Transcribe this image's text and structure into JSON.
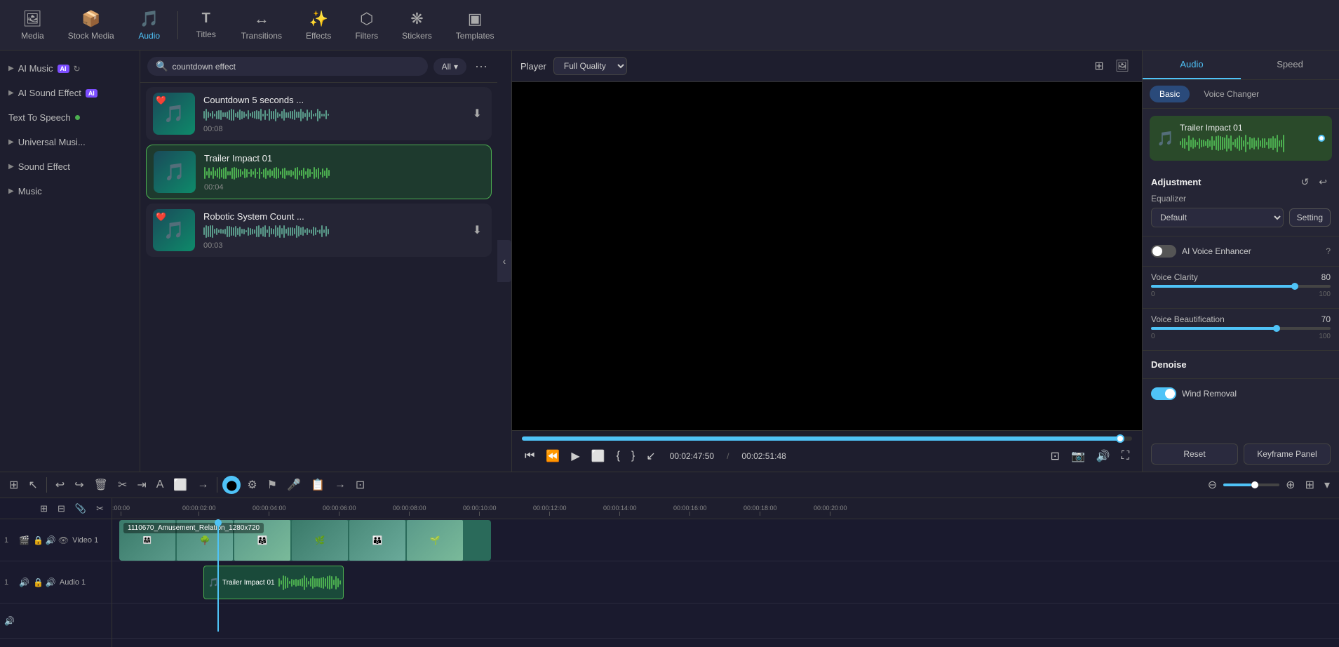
{
  "app": {
    "title": "Video Editor"
  },
  "toolbar": {
    "items": [
      {
        "id": "media",
        "label": "Media",
        "icon": "🖼",
        "active": false
      },
      {
        "id": "stock-media",
        "label": "Stock Media",
        "icon": "📦",
        "active": false
      },
      {
        "id": "audio",
        "label": "Audio",
        "icon": "🎵",
        "active": true
      },
      {
        "id": "titles",
        "label": "Titles",
        "icon": "T",
        "active": false
      },
      {
        "id": "transitions",
        "label": "Transitions",
        "icon": "↔",
        "active": false
      },
      {
        "id": "effects",
        "label": "Effects",
        "icon": "✨",
        "active": false
      },
      {
        "id": "filters",
        "label": "Filters",
        "icon": "⬡",
        "active": false
      },
      {
        "id": "stickers",
        "label": "Stickers",
        "icon": "❋",
        "active": false
      },
      {
        "id": "templates",
        "label": "Templates",
        "icon": "▣",
        "active": false
      }
    ]
  },
  "sidebar": {
    "items": [
      {
        "id": "ai-music",
        "label": "AI Music",
        "badge": "AI",
        "badge_type": "ai",
        "arrow": true
      },
      {
        "id": "ai-sound-effect",
        "label": "AI Sound Effect",
        "badge": "AI",
        "badge_type": "ai",
        "arrow": true
      },
      {
        "id": "text-to-speech",
        "label": "Text To Speech",
        "dot": true,
        "arrow": false
      },
      {
        "id": "universal-music",
        "label": "Universal Musi...",
        "arrow": true
      },
      {
        "id": "sound-effect",
        "label": "Sound Effect",
        "arrow": true
      },
      {
        "id": "music",
        "label": "Music",
        "arrow": true
      }
    ]
  },
  "search": {
    "placeholder": "countdown effect",
    "filter_label": "All",
    "more_icon": "···"
  },
  "sound_list": [
    {
      "id": "countdown",
      "name": "Countdown 5 seconds ...",
      "duration": "00:08",
      "has_heart": true,
      "selected": false
    },
    {
      "id": "trailer-impact",
      "name": "Trailer Impact 01",
      "duration": "00:04",
      "has_heart": false,
      "selected": true
    },
    {
      "id": "robotic-system",
      "name": "Robotic System Count ...",
      "duration": "00:03",
      "has_heart": true,
      "selected": false
    }
  ],
  "player": {
    "label": "Player",
    "quality": "Full Quality",
    "current_time": "00:02:47:50",
    "total_time": "00:02:51:48",
    "progress_pct": 98,
    "progress_handle_pct": 98
  },
  "right_panel": {
    "tabs": [
      {
        "id": "audio",
        "label": "Audio",
        "active": true
      },
      {
        "id": "speed",
        "label": "Speed",
        "active": false
      }
    ],
    "sub_tabs": [
      {
        "id": "basic",
        "label": "Basic",
        "active": true
      },
      {
        "id": "voice-changer",
        "label": "Voice Changer",
        "active": false
      }
    ],
    "audio_preview": {
      "title": "Trailer Impact 01",
      "icon": "🎵"
    },
    "adjustment": {
      "title": "Adjustment",
      "reset_icon": "↺",
      "undo_icon": "↩"
    },
    "equalizer": {
      "label": "Equalizer",
      "default_option": "Default",
      "setting_label": "Setting"
    },
    "ai_voice_enhancer": {
      "label": "AI Voice Enhancer",
      "enabled": false
    },
    "voice_clarity": {
      "label": "Voice Clarity",
      "value": 80,
      "min": 0,
      "max": 100,
      "fill_pct": 80
    },
    "voice_beautification": {
      "label": "Voice Beautification",
      "value": 70,
      "min": 0,
      "max": 100,
      "fill_pct": 70
    },
    "denoise": {
      "label": "Denoise"
    },
    "wind_removal": {
      "label": "Wind Removal",
      "enabled": true
    },
    "buttons": {
      "reset": "Reset",
      "keyframe": "Keyframe Panel"
    }
  },
  "timeline": {
    "toolbar_icons": [
      "⊞",
      "⊟",
      "🗑",
      "✂",
      "⇥",
      "A",
      "⬜",
      "→"
    ],
    "playhead_pct": 15,
    "zoom_pct": 50,
    "ruler": {
      "marks": [
        "00:00",
        "00:00:02:00",
        "00:00:04:00",
        "00:00:06:00",
        "00:00:08:00",
        "00:00:10:00",
        "00:00:12:00",
        "00:00:14:00",
        "00:00:16:00",
        "00:00:18:00",
        "00:00:20:00"
      ]
    },
    "tracks": [
      {
        "id": "video-1",
        "type": "video",
        "num": "1",
        "label": "Video 1",
        "clip": {
          "label": "1110670_Amusement_Relation_1280x720",
          "start_pct": 1,
          "width_pct": 43
        }
      },
      {
        "id": "audio-1",
        "type": "audio",
        "num": "1",
        "label": "Audio 1",
        "clip": {
          "label": "Trailer Impact 01",
          "start_pct": 9,
          "width_pct": 13
        }
      }
    ]
  }
}
